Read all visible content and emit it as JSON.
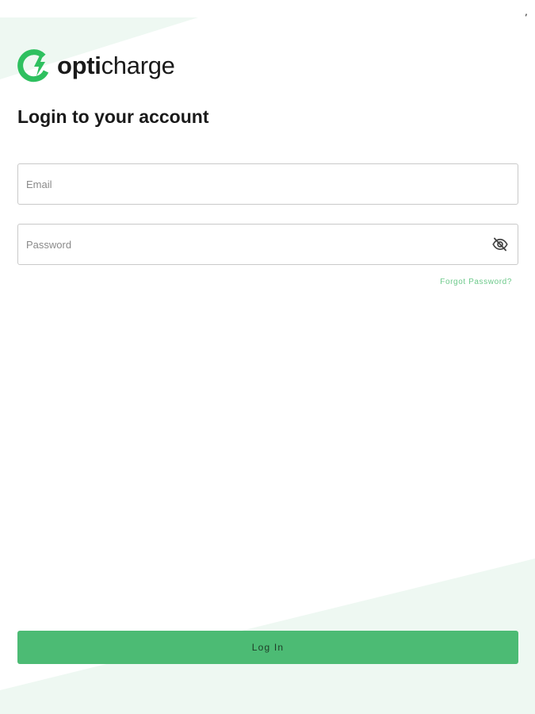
{
  "status": {
    "indicator": ","
  },
  "brand": {
    "name_bold": "opti",
    "name_light": "charge",
    "accent_color": "#2ec05f",
    "icon": "charge-ring-bolt-icon"
  },
  "login": {
    "title": "Login to your account",
    "email": {
      "placeholder": "Email",
      "value": ""
    },
    "password": {
      "placeholder": "Password",
      "value": "",
      "toggle_icon": "eye-off-icon"
    },
    "forgot_password": "Forgot Password?",
    "submit_label": "Log In"
  },
  "colors": {
    "primary_button": "#4cbb74",
    "link": "#6cc98a",
    "background_tint": "#edf8f1"
  }
}
